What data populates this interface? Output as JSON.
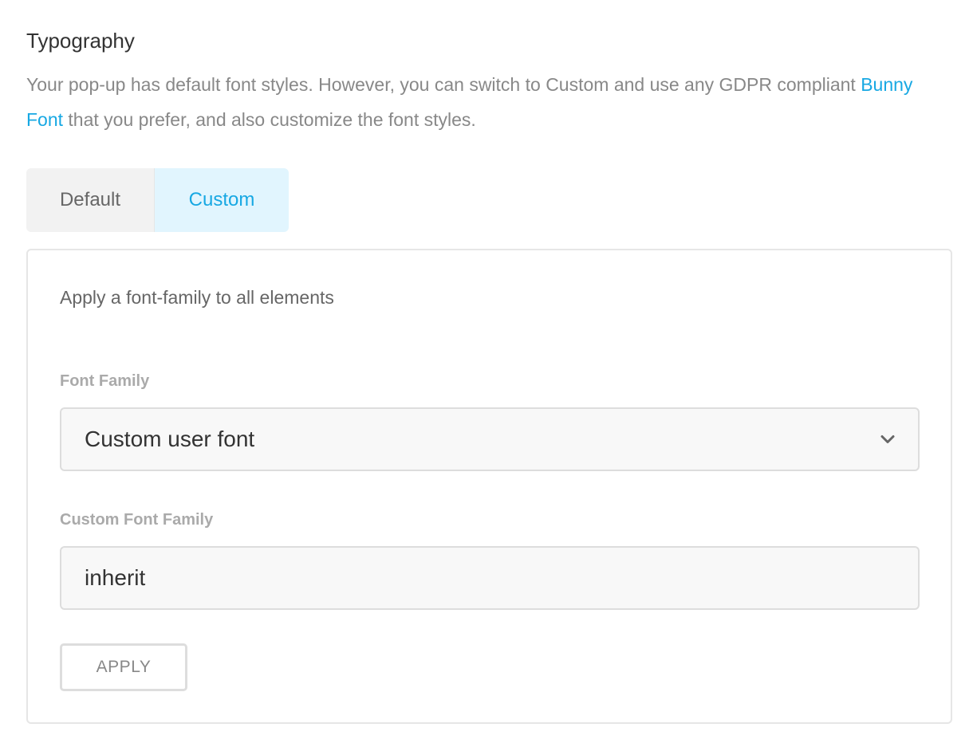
{
  "typography": {
    "title": "Typography",
    "description_before_link": "Your pop-up has default font styles. However, you can switch to Custom and use any GDPR compliant ",
    "link_text": "Bunny Font",
    "description_after_link": " that you prefer, and also customize the font styles."
  },
  "tabs": [
    {
      "label": "Default",
      "selected": false
    },
    {
      "label": "Custom",
      "selected": true
    }
  ],
  "panel": {
    "heading": "Apply a font-family to all elements",
    "font_family": {
      "label": "Font Family",
      "selected_value": "Custom user font"
    },
    "custom_font_family": {
      "label": "Custom Font Family",
      "value": "inherit"
    },
    "apply_label": "APPLY"
  },
  "colors": {
    "accent": "#17a8e3",
    "selected_tab_bg": "#e1f5fe",
    "muted_text": "#888888",
    "border": "#dddddd"
  },
  "icons": {
    "select_chevron": "chevron-down-icon"
  }
}
